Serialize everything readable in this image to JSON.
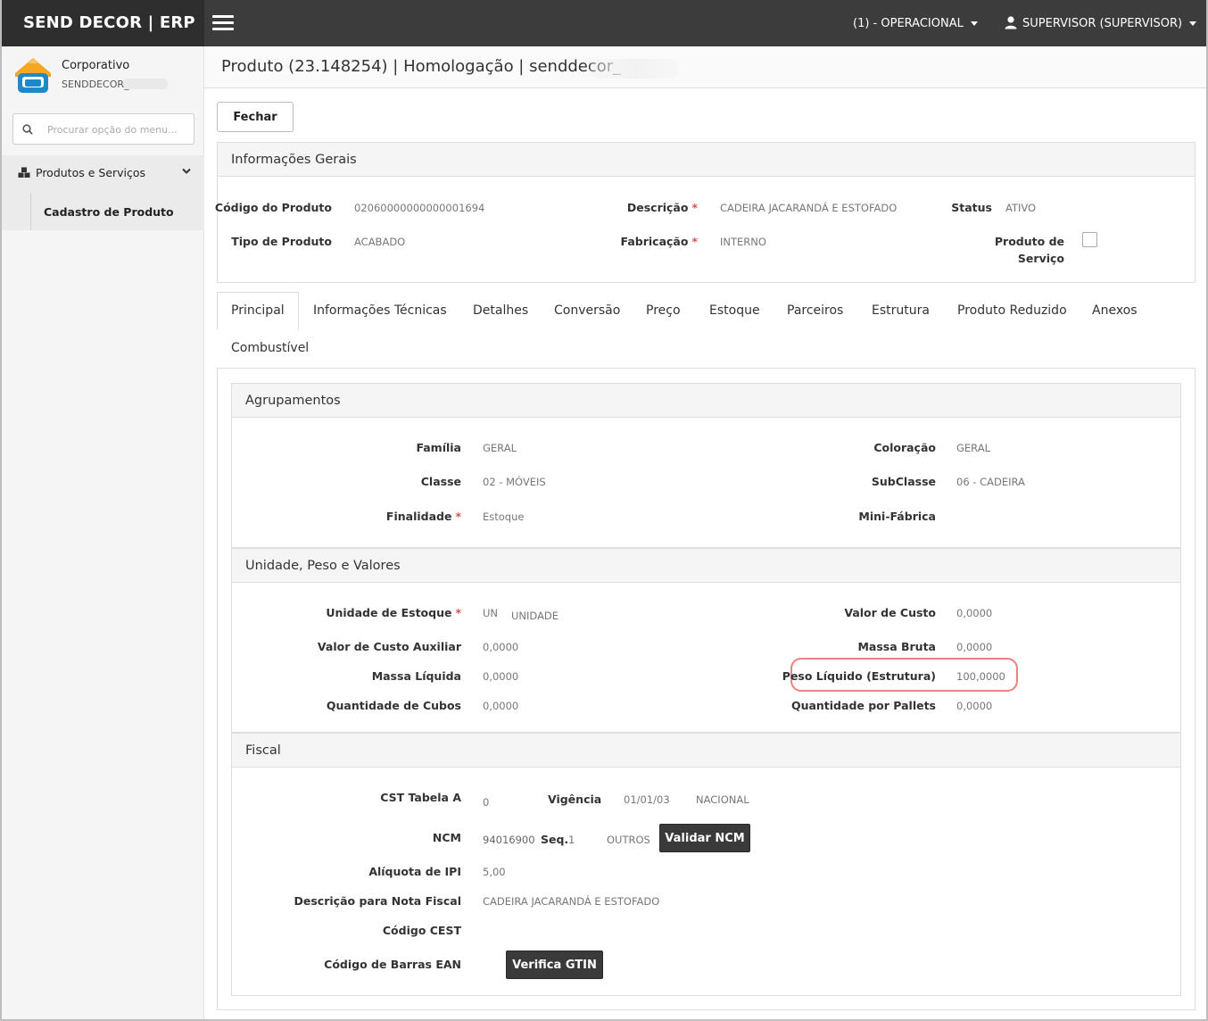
{
  "topbar": {
    "brand": "SEND DECOR | ERP",
    "context": "(1) - OPERACIONAL",
    "user": "SUPERVISOR (SUPERVISOR)"
  },
  "sidebar": {
    "profile_name": "Corporativo",
    "profile_sub": "SENDDECOR_",
    "search_placeholder": "Procurar opção do menu...",
    "group": "Produtos e Serviços",
    "child": "Cadastro de Produto"
  },
  "page": {
    "title": "Produto (23.148254) | Homologação | senddecor_",
    "close_button": "Fechar"
  },
  "general": {
    "heading": "Informações Gerais",
    "codigo_label": "Código do Produto",
    "codigo_value": "02060000000000001694",
    "descricao_label": "Descrição",
    "descricao_value": "CADEIRA JACARANDÁ E ESTOFADO",
    "status_label": "Status",
    "status_value": "ATIVO",
    "tipo_label": "Tipo de Produto",
    "tipo_value": "ACABADO",
    "fabricacao_label": "Fabricação",
    "fabricacao_value": "INTERNO",
    "servico_label_1": "Produto de",
    "servico_label_2": "Serviço",
    "required_mark": "*"
  },
  "tabs": [
    "Principal",
    "Informações Técnicas",
    "Detalhes",
    "Conversão",
    "Preço",
    "Estoque",
    "Parceiros",
    "Estrutura",
    "Produto Reduzido",
    "Anexos",
    "Combustível"
  ],
  "agrupamentos": {
    "heading": "Agrupamentos",
    "familia_label": "Família",
    "familia_value": "GERAL",
    "coloracao_label": "Coloração",
    "coloracao_value": "GERAL",
    "classe_label": "Classe",
    "classe_value": "02 - MÓVEIS",
    "subclasse_label": "SubClasse",
    "subclasse_value": "06 - CADEIRA",
    "finalidade_label": "Finalidade",
    "finalidade_value": "Estoque",
    "minifabrica_label": "Mini-Fábrica"
  },
  "unidade": {
    "heading": "Unidade, Peso e Valores",
    "unidade_label": "Unidade de Estoque",
    "unidade_code": "UN",
    "unidade_value": "UNIDADE",
    "valor_custo_label": "Valor de Custo",
    "valor_custo_value": "0,0000",
    "valor_aux_label": "Valor de Custo Auxiliar",
    "valor_aux_value": "0,0000",
    "massa_bruta_label": "Massa Bruta",
    "massa_bruta_value": "0,0000",
    "massa_liquida_label": "Massa Líquida",
    "massa_liquida_value": "0,0000",
    "peso_liquido_label": "Peso Líquido (Estrutura)",
    "peso_liquido_value": "100,0000",
    "cubos_label": "Quantidade de Cubos",
    "cubos_value": "0,0000",
    "pallets_label": "Quantidade por Pallets",
    "pallets_value": "0,0000"
  },
  "fiscal": {
    "heading": "Fiscal",
    "cst_label": "CST Tabela A",
    "cst_value": "0",
    "vigencia_label": "Vigência",
    "vigencia_value": "01/01/03",
    "origem_value": "NACIONAL",
    "ncm_label": "NCM",
    "ncm_value": "94016900",
    "seq_label": "Seq.",
    "seq_value": "1",
    "outros_value": "OUTROS",
    "validar_button": "Validar NCM",
    "ipi_label": "Alíquota de IPI",
    "ipi_value": "5,00",
    "descricao_nf_label": "Descrição para Nota Fiscal",
    "descricao_nf_value": "CADEIRA JACARANDÁ E ESTOFADO",
    "cest_label": "Código CEST",
    "ean_label": "Código de Barras EAN",
    "gtin_button": "Verifica GTIN"
  },
  "colors": {
    "topbar": "#3c3c3c",
    "required": "#d9534f",
    "highlight": "#f08080",
    "logo_orange": "#f5a623",
    "logo_blue": "#1e88c8"
  }
}
